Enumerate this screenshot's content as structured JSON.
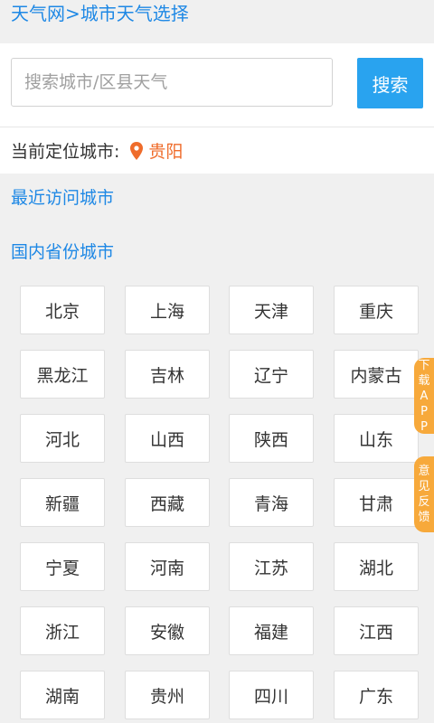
{
  "breadcrumb": "天气网>城市天气选择",
  "search": {
    "placeholder": "搜索城市/区县天气",
    "button_label": "搜索"
  },
  "location": {
    "label": "当前定位城市:",
    "city": "贵阳",
    "accent_color": "#ef6c2b"
  },
  "sections": {
    "recent": "最近访问城市",
    "domestic": "国内省份城市"
  },
  "provinces": [
    "北京",
    "上海",
    "天津",
    "重庆",
    "黑龙江",
    "吉林",
    "辽宁",
    "内蒙古",
    "河北",
    "山西",
    "陕西",
    "山东",
    "新疆",
    "西藏",
    "青海",
    "甘肃",
    "宁夏",
    "河南",
    "江苏",
    "湖北",
    "浙江",
    "安徽",
    "福建",
    "江西",
    "湖南",
    "贵州",
    "四川",
    "广东"
  ],
  "side_tabs": {
    "download_app": "下载APP",
    "feedback": "意见反馈"
  },
  "colors": {
    "link_blue": "#1e88e5",
    "button_blue": "#29a3ef",
    "tab_orange": "#f7a93b"
  }
}
